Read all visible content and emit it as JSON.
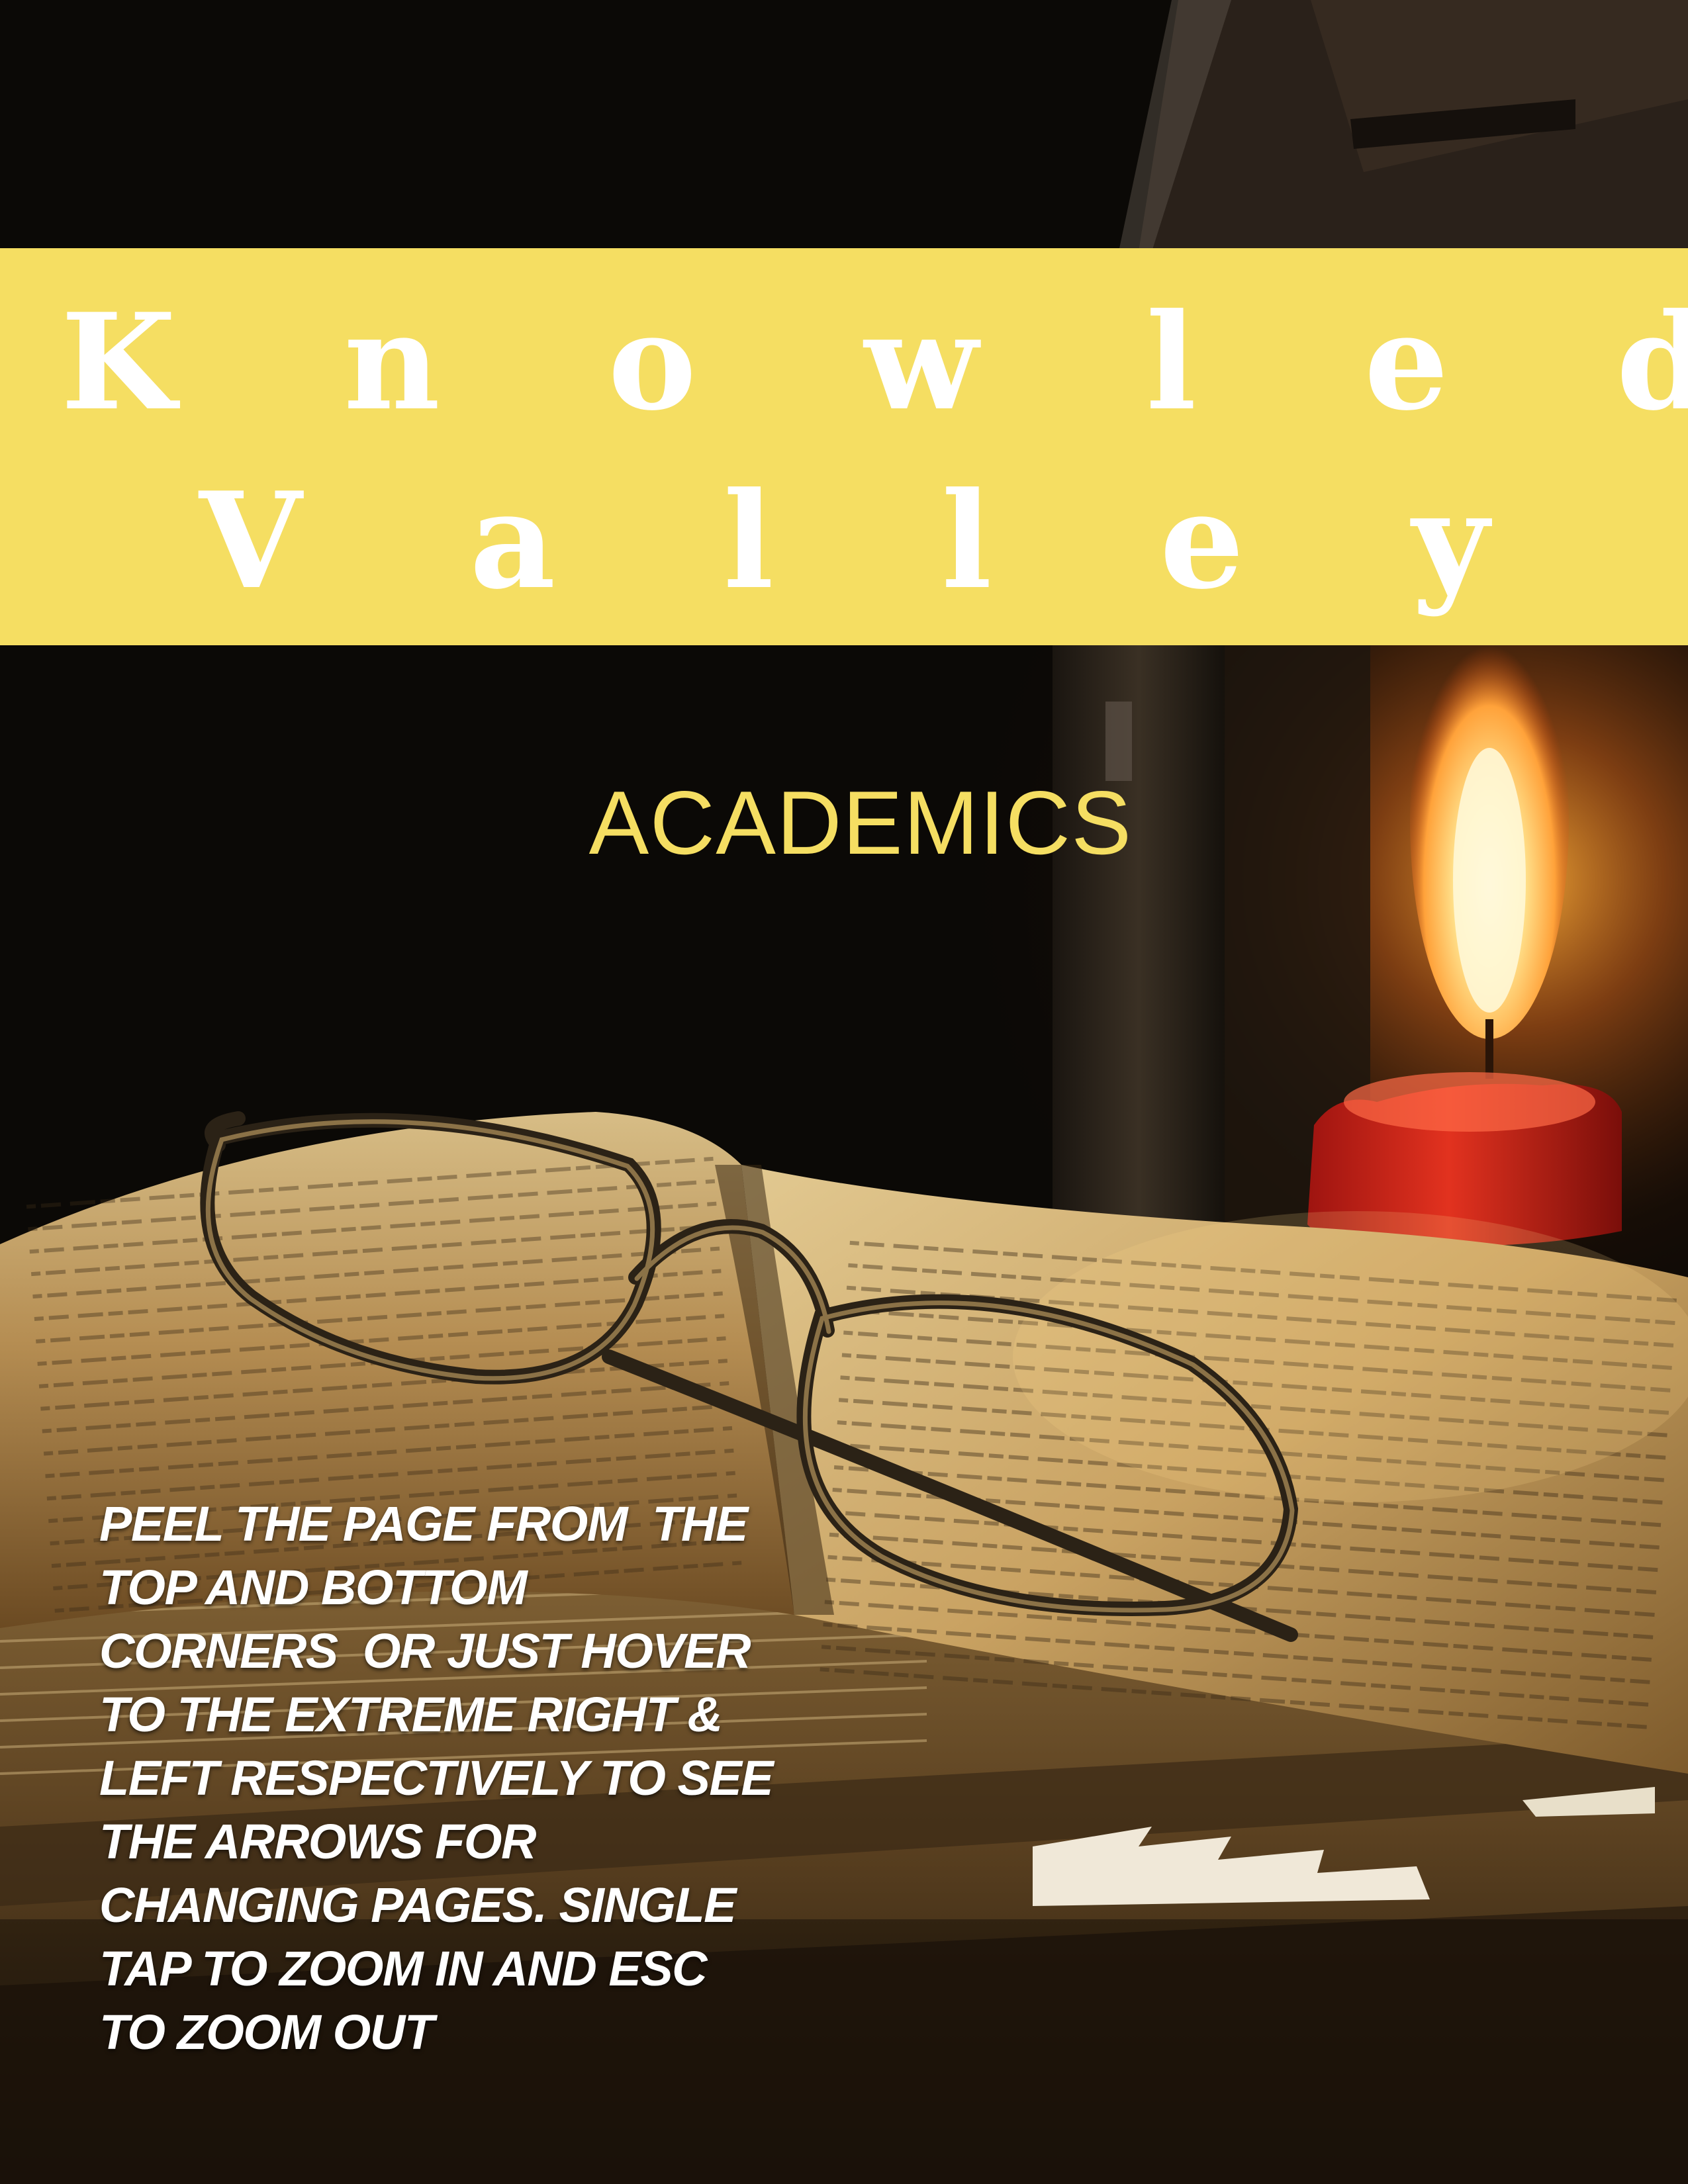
{
  "cover": {
    "title_line_1": "K n o w l e d g e",
    "title_line_2": "V a l l e y",
    "subtitle": "ACADEMICS",
    "instructions_lines": [
      "PEEL THE PAGE FROM  THE",
      "TOP AND BOTTOM",
      "CORNERS  OR JUST HOVER",
      "TO THE EXTREME RIGHT &",
      "LEFT RESPECTIVELY TO SEE",
      "THE ARROWS FOR",
      "CHANGING PAGES. SINGLE",
      "TAP TO ZOOM IN AND ESC",
      "TO ZOOM OUT"
    ]
  },
  "colors": {
    "band": "#f5de62",
    "title_text": "#ffffff",
    "subtitle_text": "#f5de62",
    "background": "#0b0906",
    "candle": "#d8261b",
    "flame": "#ffd36a"
  },
  "icons": {
    "background_image": "candle-book-glasses-photo"
  }
}
